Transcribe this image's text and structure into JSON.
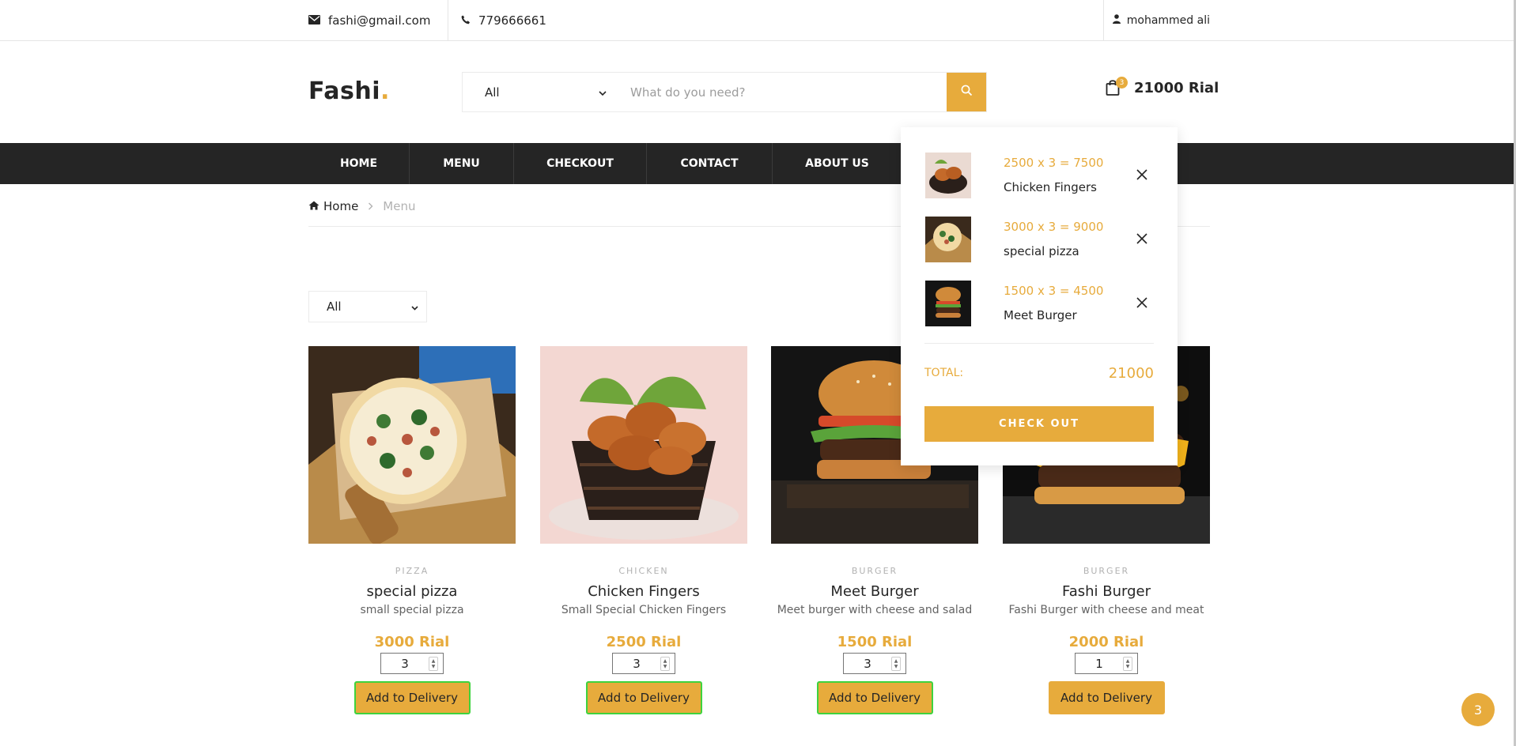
{
  "topbar": {
    "email": "fashi@gmail.com",
    "phone": "779666661",
    "user": "mohammed ali"
  },
  "header": {
    "logo": "Fashi",
    "logo_dot": ".",
    "search_category": "All",
    "search_placeholder": "What do you need?",
    "cart_count": "3",
    "cart_total": "21000 Rial"
  },
  "nav": {
    "items": [
      {
        "label": "HOME"
      },
      {
        "label": "MENU"
      },
      {
        "label": "CHECKOUT"
      },
      {
        "label": "CONTACT"
      },
      {
        "label": "ABOUT US"
      }
    ]
  },
  "breadcrumb": {
    "home": "Home",
    "current": "Menu"
  },
  "filter": {
    "selected": "All"
  },
  "products": [
    {
      "category": "PIZZA",
      "name": "special pizza",
      "desc": "small special pizza",
      "price": "3000 Rial",
      "qty": "3",
      "button": "Add to Delivery"
    },
    {
      "category": "CHICKEN",
      "name": "Chicken Fingers",
      "desc": "Small Special Chicken Fingers",
      "price": "2500 Rial",
      "qty": "3",
      "button": "Add to Delivery"
    },
    {
      "category": "BURGER",
      "name": "Meet Burger",
      "desc": "Meet burger with cheese and salad",
      "price": "1500 Rial",
      "qty": "3",
      "button": "Add to Delivery"
    },
    {
      "category": "BURGER",
      "name": "Fashi Burger",
      "desc": "Fashi Burger with cheese and meat",
      "price": "2000 Rial",
      "qty": "1",
      "button": "Add to Delivery"
    }
  ],
  "cart": {
    "items": [
      {
        "calc": "2500 x 3 = 7500",
        "name": "Chicken Fingers"
      },
      {
        "calc": "3000 x 3 = 9000",
        "name": "special pizza"
      },
      {
        "calc": "1500 x 3 = 4500",
        "name": "Meet Burger"
      }
    ],
    "total_label": "TOTAL:",
    "total_value": "21000",
    "checkout_label": "CHECK OUT"
  },
  "float_badge": "3",
  "colors": {
    "accent": "#e7ab3c",
    "dark": "#252525",
    "green_outline": "#3ed33e"
  }
}
